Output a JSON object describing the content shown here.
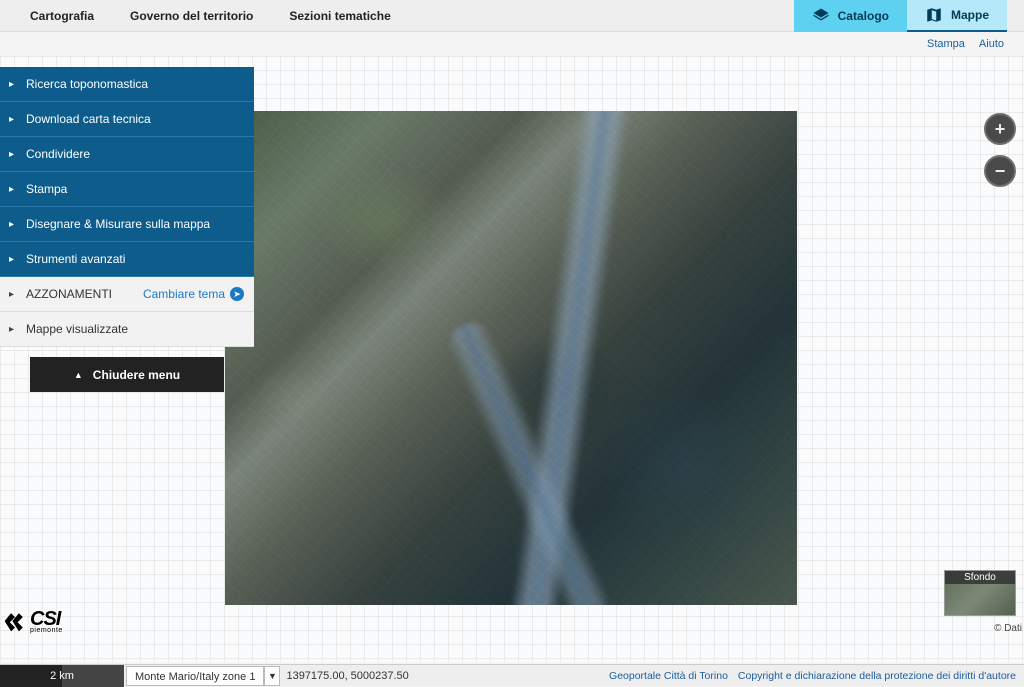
{
  "topnav": {
    "items": [
      "Cartografia",
      "Governo del territorio",
      "Sezioni tematiche"
    ],
    "tabs": {
      "catalogo": "Catalogo",
      "mappe": "Mappe"
    }
  },
  "sublinks": {
    "stampa": "Stampa",
    "aiuto": "Aiuto"
  },
  "sidemenu": {
    "primary": [
      "Ricerca toponomastica",
      "Download carta tecnica",
      "Condividere",
      "Stampa",
      "Disegnare & Misurare sulla mappa",
      "Strumenti avanzati"
    ],
    "secondary": {
      "azzonamenti": "AZZONAMENTI",
      "change_theme": "Cambiare tema",
      "mappe_vis": "Mappe visualizzate"
    },
    "close": "Chiudere menu"
  },
  "overview_label": "Sfondo",
  "attribution": "© Dati",
  "logo": {
    "main": "CSI",
    "sub": "piemonte"
  },
  "statusbar": {
    "scale": "2 km",
    "projection": "Monte Mario/Italy zone 1",
    "coords": "1397175.00, 5000237.50"
  },
  "footer_links": {
    "geoportale": "Geoportale Città di Torino",
    "copyright": "Copyright e dichiarazione della protezione dei diritti d'autore"
  }
}
